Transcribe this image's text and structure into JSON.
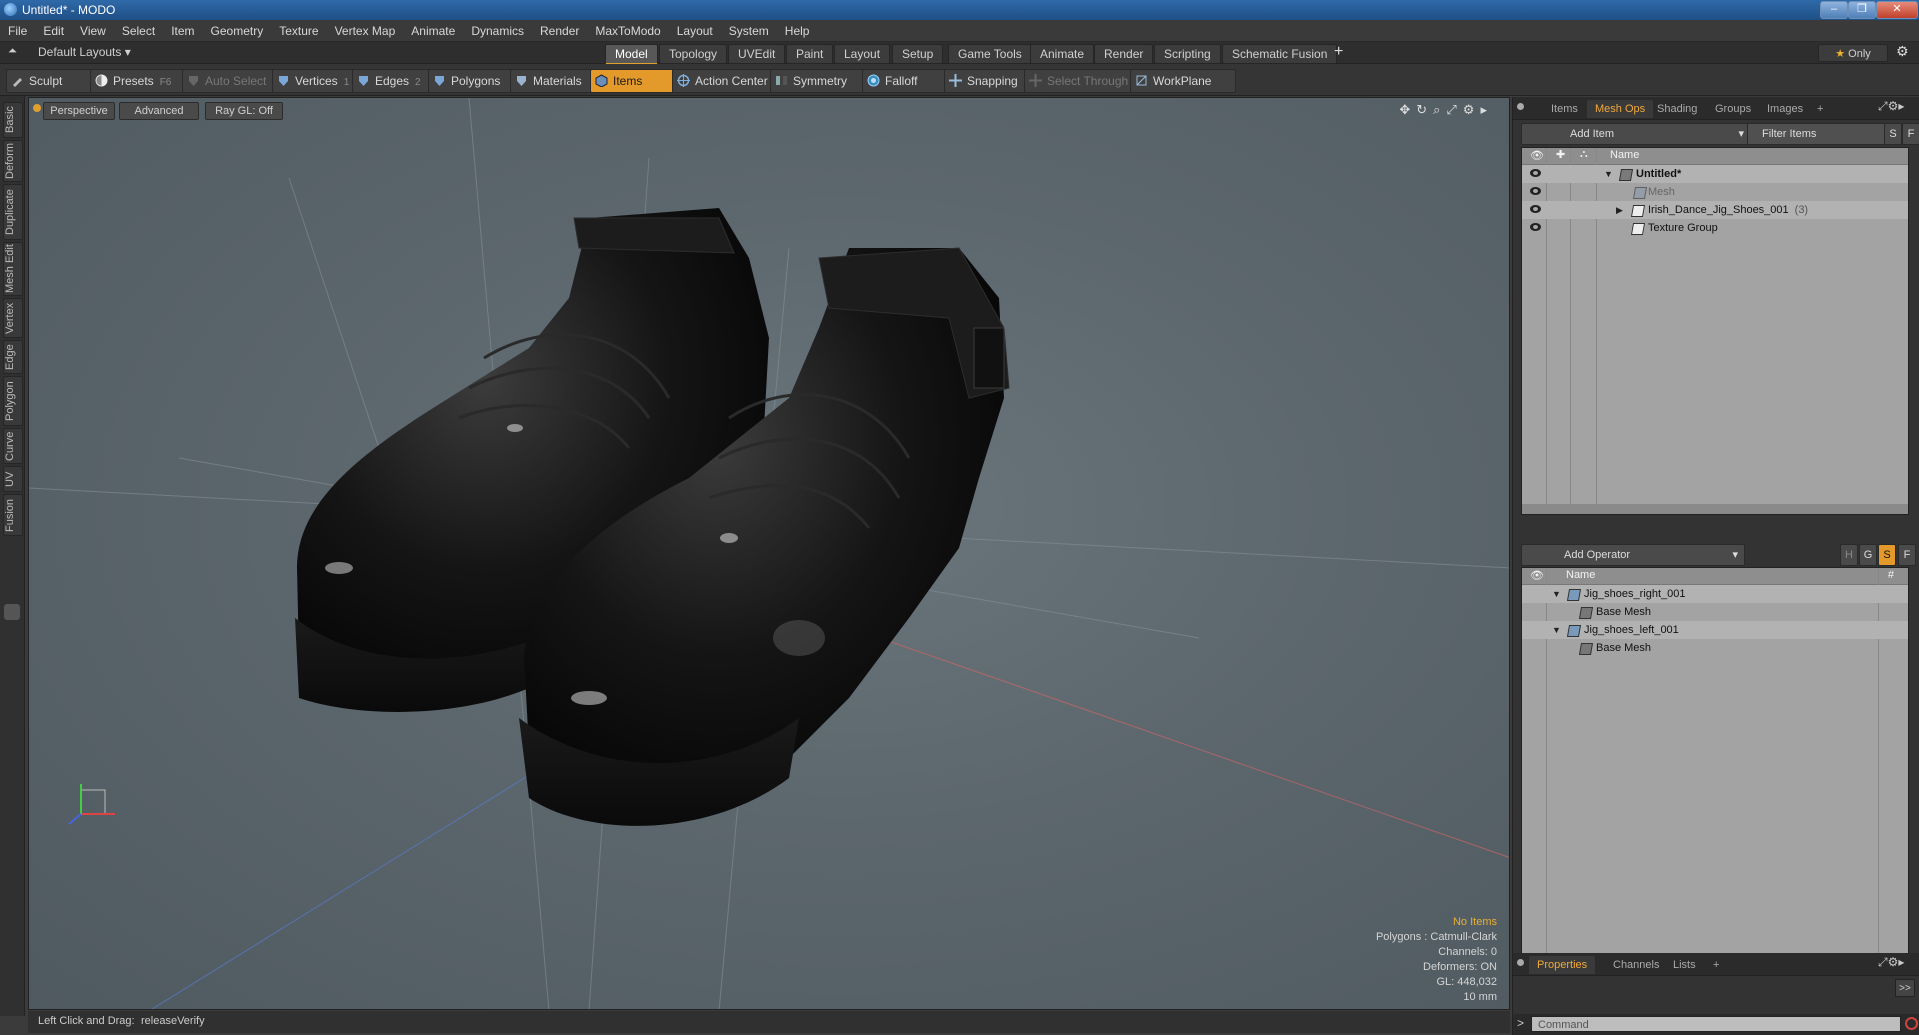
{
  "window": {
    "title": "Untitled* - MODO"
  },
  "menu": [
    "File",
    "Edit",
    "View",
    "Select",
    "Item",
    "Geometry",
    "Texture",
    "Vertex Map",
    "Animate",
    "Dynamics",
    "Render",
    "MaxToModo",
    "Layout",
    "System",
    "Help"
  ],
  "layoutbar": {
    "layout_name": "Default Layouts ▾",
    "tabs": [
      "Model",
      "Topology",
      "UVEdit",
      "Paint",
      "Layout",
      "Setup",
      "Game Tools",
      "Animate",
      "Render",
      "Scripting",
      "Schematic Fusion"
    ],
    "active_tab": "Model",
    "plus": "+",
    "only": "Only"
  },
  "toolbar": {
    "sculpt": "Sculpt",
    "presets": "Presets",
    "presets_key": "F6",
    "auto_select": "Auto Select",
    "vertices": "Vertices",
    "vertices_num": "1",
    "edges": "Edges",
    "edges_num": "2",
    "polygons": "Polygons",
    "materials": "Materials",
    "items": "Items",
    "action_center": "Action Center",
    "symmetry": "Symmetry",
    "falloff": "Falloff",
    "snapping": "Snapping",
    "select_through": "Select Through",
    "workplane": "WorkPlane"
  },
  "left_tabs": [
    "Basic",
    "Deform",
    "Duplicate",
    "Mesh Edit",
    "Vertex",
    "Edge",
    "Polygon",
    "Curve",
    "UV",
    "Fusion"
  ],
  "viewport": {
    "view": "Perspective",
    "shading": "Advanced",
    "raygl": "Ray GL: Off",
    "info": {
      "selection": "No Items",
      "polygons": "Polygons : Catmull-Clark",
      "channels": "Channels: 0",
      "deformers": "Deformers: ON",
      "gl": "GL: 448,032",
      "scale": "10 mm"
    }
  },
  "status": {
    "hint": "Left Click and Drag:",
    "action": "releaseVerify"
  },
  "items_panel": {
    "tabs": [
      "Items",
      "Mesh Ops",
      "Shading",
      "Groups",
      "Images",
      "+"
    ],
    "active_tab": "Mesh Ops",
    "add_item": "Add Item",
    "filter": "Filter Items",
    "s_btn": "S",
    "f_btn": "F",
    "col_name": "Name",
    "rows": [
      {
        "label": "Untitled*",
        "count": ""
      },
      {
        "label": "Mesh",
        "count": ""
      },
      {
        "label": "Irish_Dance_Jig_Shoes_001",
        "count": "(3)"
      },
      {
        "label": "Texture Group",
        "count": ""
      }
    ]
  },
  "meshops_panel": {
    "add_operator": "Add Operator",
    "btn_h": "H",
    "btn_g": "G",
    "btn_s": "S",
    "btn_f": "F",
    "col_name": "Name",
    "col_hash": "#",
    "rows": [
      {
        "label": "Jig_shoes_right_001"
      },
      {
        "label": "Base Mesh"
      },
      {
        "label": "Jig_shoes_left_001"
      },
      {
        "label": "Base Mesh"
      }
    ]
  },
  "properties_panel": {
    "tabs": [
      "Properties",
      "Channels",
      "Lists",
      "+"
    ],
    "active_tab": "Properties",
    "expand": ">>"
  },
  "command": {
    "placeholder": "Command"
  },
  "colors": {
    "accent": "#e39a2a",
    "viewport_bg": "#5c676d"
  }
}
